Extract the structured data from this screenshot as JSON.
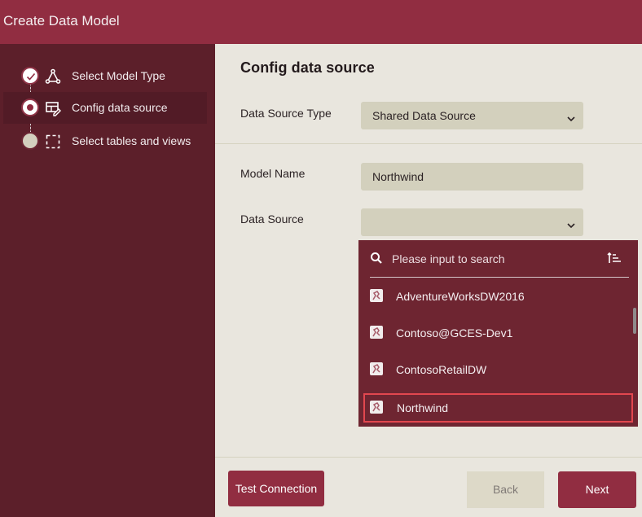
{
  "window": {
    "title": "Create Data Model"
  },
  "colors": {
    "brand": "#912d41",
    "sidebar": "#5c1f2a",
    "dropdown_bg": "#6e2531",
    "selection_border": "#e2474f",
    "field_bg": "#d3d0bd"
  },
  "steps": [
    {
      "label": "Select Model Type",
      "state": "completed",
      "icon": "model-type-icon"
    },
    {
      "label": "Config data source",
      "state": "current",
      "icon": "table-edit-icon"
    },
    {
      "label": "Select tables and views",
      "state": "pending",
      "icon": "dashed-select-icon"
    }
  ],
  "main": {
    "heading": "Config data source",
    "data_source_type": {
      "label": "Data Source Type",
      "value": "Shared Data Source"
    },
    "model_name": {
      "label": "Model Name",
      "value": "Northwind"
    },
    "data_source": {
      "label": "Data Source",
      "value": ""
    }
  },
  "dropdown": {
    "search_placeholder": "Please input to search",
    "items": [
      {
        "name": "AdventureWorksDW2016",
        "selected": false
      },
      {
        "name": "Contoso@GCES-Dev1",
        "selected": false
      },
      {
        "name": "ContosoRetailDW",
        "selected": false
      },
      {
        "name": "Northwind",
        "selected": true
      }
    ]
  },
  "footer": {
    "test_connection": "Test Connection",
    "back": "Back",
    "next": "Next"
  }
}
